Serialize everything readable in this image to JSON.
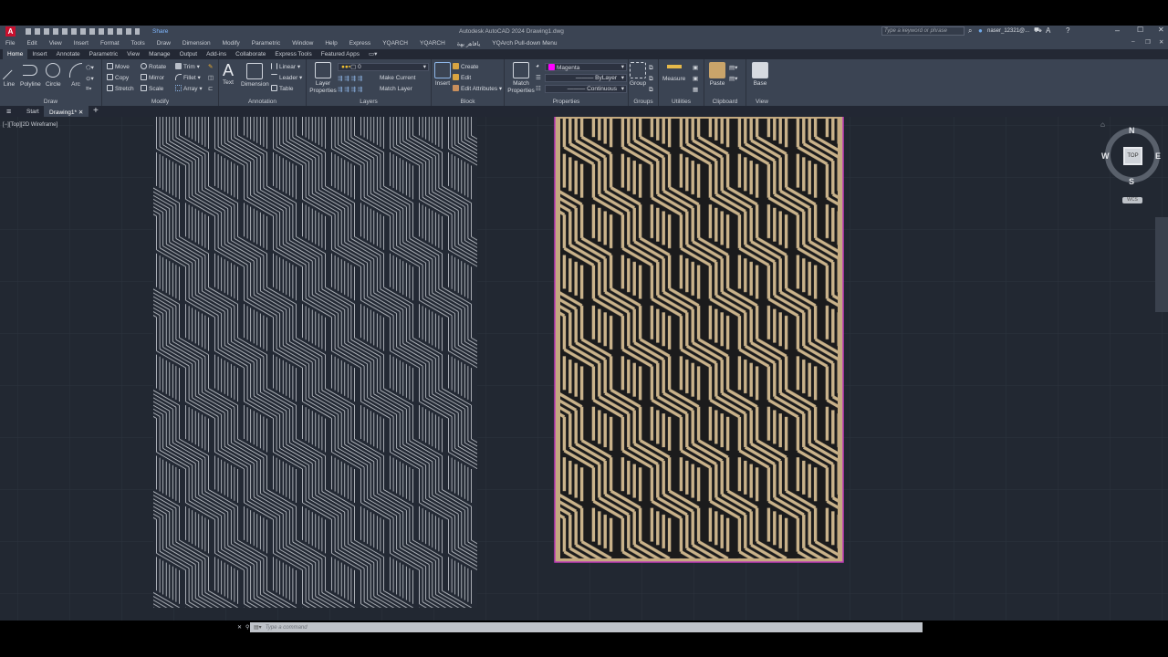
{
  "title_bar": {
    "title": "Autodesk AutoCAD 2024   Drawing1.dwg",
    "share": "Share",
    "search_placeholder": "Type a keyword or phrase",
    "user": "naser_12321@...",
    "app_icon": "A"
  },
  "menu": [
    "File",
    "Edit",
    "View",
    "Insert",
    "Format",
    "Tools",
    "Draw",
    "Dimension",
    "Modify",
    "Parametric",
    "Window",
    "Help",
    "Express",
    "YQARCH",
    "YQARCH",
    "ﻳﺎﻓﺎﻫﺭ ﻳﻬﺓ",
    "YQArch Pull-down Menu"
  ],
  "ribbon_tabs": [
    "Home",
    "Insert",
    "Annotate",
    "Parametric",
    "View",
    "Manage",
    "Output",
    "Add-ins",
    "Collaborate",
    "Express Tools",
    "Featured Apps"
  ],
  "ribbon": {
    "draw": {
      "title": "Draw",
      "line": "Line",
      "polyline": "Polyline",
      "circle": "Circle",
      "arc": "Arc"
    },
    "modify": {
      "title": "Modify",
      "move": "Move",
      "rotate": "Rotate",
      "trim": "Trim",
      "copy": "Copy",
      "mirror": "Mirror",
      "fillet": "Fillet",
      "stretch": "Stretch",
      "scale": "Scale",
      "array": "Array"
    },
    "annotation": {
      "title": "Annotation",
      "text": "Text",
      "dimension": "Dimension",
      "linear": "Linear",
      "leader": "Leader",
      "table": "Table"
    },
    "layers": {
      "title": "Layers",
      "layer_properties": "Layer Properties",
      "current_layer": "0",
      "make_current": "Make Current",
      "match_layer": "Match Layer"
    },
    "block": {
      "title": "Block",
      "insert": "Insert",
      "create": "Create",
      "edit": "Edit",
      "edit_attributes": "Edit Attributes"
    },
    "properties": {
      "title": "Properties",
      "match_properties": "Match Properties",
      "color": "Magenta",
      "lineweight": "ByLayer",
      "linetype": "Continuous"
    },
    "groups": {
      "title": "Groups",
      "group": "Group"
    },
    "utilities": {
      "title": "Utilities",
      "measure": "Measure"
    },
    "clipboard": {
      "title": "Clipboard",
      "paste": "Paste"
    },
    "view": {
      "title": "View",
      "base": "Base"
    }
  },
  "file_tabs": {
    "start": "Start",
    "drawing": "Drawing1*"
  },
  "viewport_label": "[−][Top][2D Wireframe]",
  "viewcube": {
    "n": "N",
    "s": "S",
    "e": "E",
    "w": "W",
    "face": "TOP",
    "wcs": "WCS"
  },
  "command_placeholder": "Type a command",
  "colors": {
    "accent": "#c8102e",
    "magenta": "#ff00ff",
    "panel_gold": "#c9b28a"
  }
}
